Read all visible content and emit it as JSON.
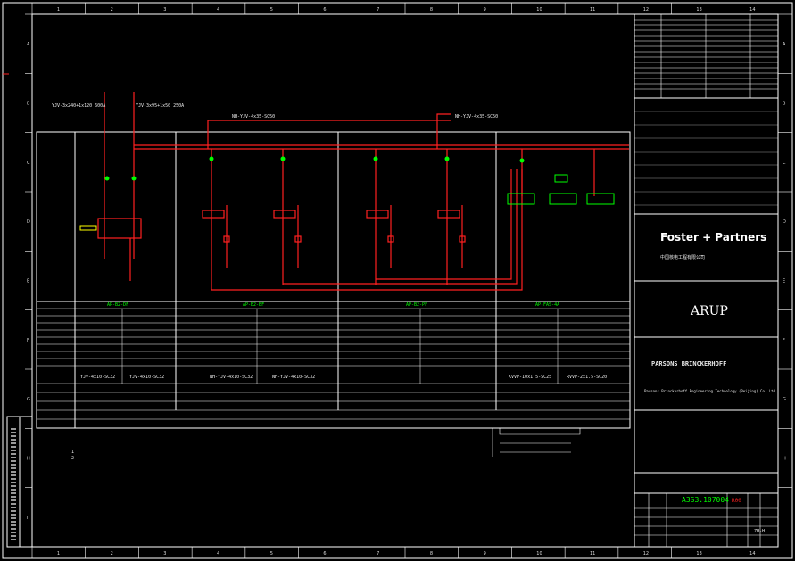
{
  "title_block": {
    "firm_1": "Foster + Partners",
    "firm_1_sub": "中国核电工程有限公司",
    "firm_2": "ARUP",
    "firm_3": "PARSONS BRINCKERHOFF",
    "firm_3_sub": "Parsons Brinckerhoff Engineering Technology (Beijing) Co. Ltd.",
    "drawing_no": "A3S3.107004",
    "revision": "R00",
    "sheet_flag": "ZH-H"
  },
  "border": {
    "columns": [
      "1",
      "2",
      "3",
      "4",
      "5",
      "6",
      "7",
      "8",
      "9",
      "10",
      "11",
      "12",
      "13",
      "14"
    ],
    "rows": [
      "A",
      "B",
      "C",
      "D",
      "E",
      "F",
      "G",
      "H",
      "I"
    ]
  },
  "circuit_refs": {
    "main_cable": "YJV-3x240+1x120 600A",
    "tap_cable": "YJV-3x95+1x50 250A",
    "fire_bus": "NH-YJV-4x35-SC50"
  },
  "panel_ids": [
    "AP-B2-DF",
    "AP-B2-BF",
    "AP-B2-PF",
    "AP-FAS-4A"
  ],
  "outgoing_cables": [
    "YJV-4x10-SC32",
    "YJV-4x10-SC32",
    "NH-YJV-4x10-SC32",
    "NH-YJV-4x10-SC32",
    "KVVP-10x1.5-SC25",
    "RVVP-2x1.5-SC20"
  ],
  "notes": [
    "1",
    "2"
  ],
  "colors": {
    "background": "#000000",
    "frame": "#ffffff",
    "circuit": "#ff2020",
    "breaker": "#00ff00",
    "highlight": "#ffff00"
  }
}
